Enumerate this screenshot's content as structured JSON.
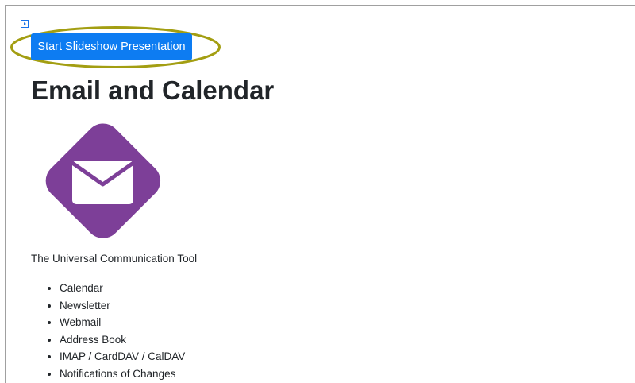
{
  "toolbar": {
    "toggle_icon": "play-square-icon",
    "slideshow_button_label": "Start Slideshow Presentation"
  },
  "page": {
    "title": "Email and Calendar",
    "logo_icon": "envelope-icon",
    "tagline": "The Universal Communication Tool",
    "features": [
      "Calendar",
      "Newsletter",
      "Webmail",
      "Address Book",
      "IMAP / CardDAV / CalDAV",
      "Notifications of Changes"
    ]
  },
  "colors": {
    "button_bg": "#0d7cf2",
    "highlight_ring": "#a39e12",
    "logo_purple": "#7d3f98",
    "text": "#212529"
  }
}
